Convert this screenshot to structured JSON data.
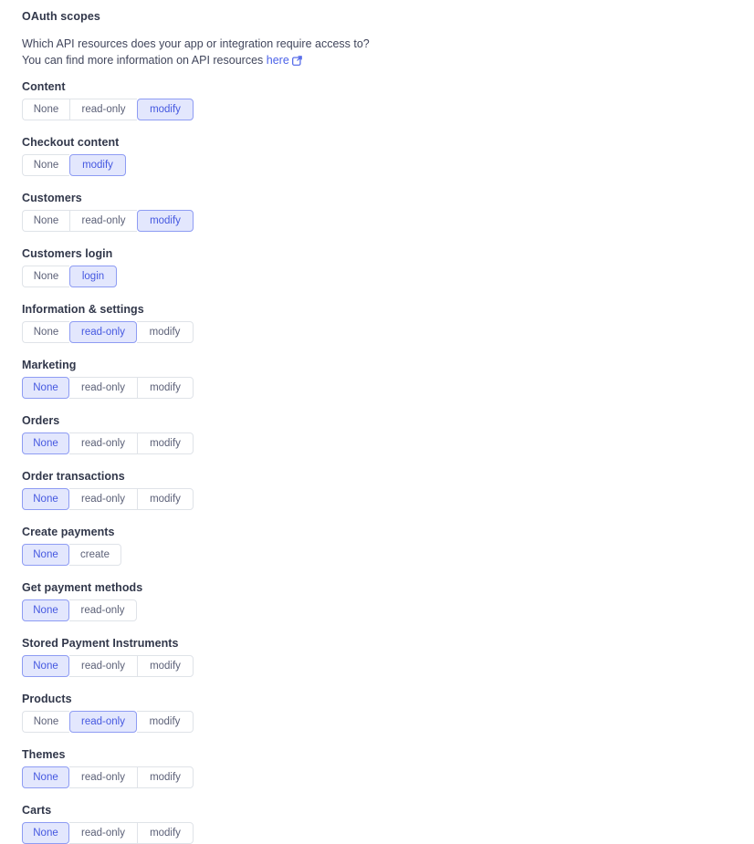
{
  "header": {
    "title": "OAuth scopes",
    "description_line1": "Which API resources does your app or integration require access to?",
    "description_line2_prefix": "You can find more information on API resources ",
    "link_label": "here",
    "link_icon": "external-link-icon"
  },
  "colors": {
    "selected_background": "#e3e7fd",
    "selected_border": "#8e9cf3",
    "selected_text": "#4558e0",
    "unselected_border": "#dfe3e8",
    "unselected_text": "#5c6178",
    "label_text": "#31374a",
    "link": "#4b62e8",
    "page_background": "#ffffff"
  },
  "scopes": [
    {
      "label": "Content",
      "options": [
        "None",
        "read-only",
        "modify"
      ],
      "selected": "modify"
    },
    {
      "label": "Checkout content",
      "options": [
        "None",
        "modify"
      ],
      "selected": "modify"
    },
    {
      "label": "Customers",
      "options": [
        "None",
        "read-only",
        "modify"
      ],
      "selected": "modify"
    },
    {
      "label": "Customers login",
      "options": [
        "None",
        "login"
      ],
      "selected": "login"
    },
    {
      "label": "Information & settings",
      "options": [
        "None",
        "read-only",
        "modify"
      ],
      "selected": "read-only"
    },
    {
      "label": "Marketing",
      "options": [
        "None",
        "read-only",
        "modify"
      ],
      "selected": "None"
    },
    {
      "label": "Orders",
      "options": [
        "None",
        "read-only",
        "modify"
      ],
      "selected": "None"
    },
    {
      "label": "Order transactions",
      "options": [
        "None",
        "read-only",
        "modify"
      ],
      "selected": "None"
    },
    {
      "label": "Create payments",
      "options": [
        "None",
        "create"
      ],
      "selected": "None"
    },
    {
      "label": "Get payment methods",
      "options": [
        "None",
        "read-only"
      ],
      "selected": "None"
    },
    {
      "label": "Stored Payment Instruments",
      "options": [
        "None",
        "read-only",
        "modify"
      ],
      "selected": "None"
    },
    {
      "label": "Products",
      "options": [
        "None",
        "read-only",
        "modify"
      ],
      "selected": "read-only"
    },
    {
      "label": "Themes",
      "options": [
        "None",
        "read-only",
        "modify"
      ],
      "selected": "None"
    },
    {
      "label": "Carts",
      "options": [
        "None",
        "read-only",
        "modify"
      ],
      "selected": "None"
    }
  ]
}
